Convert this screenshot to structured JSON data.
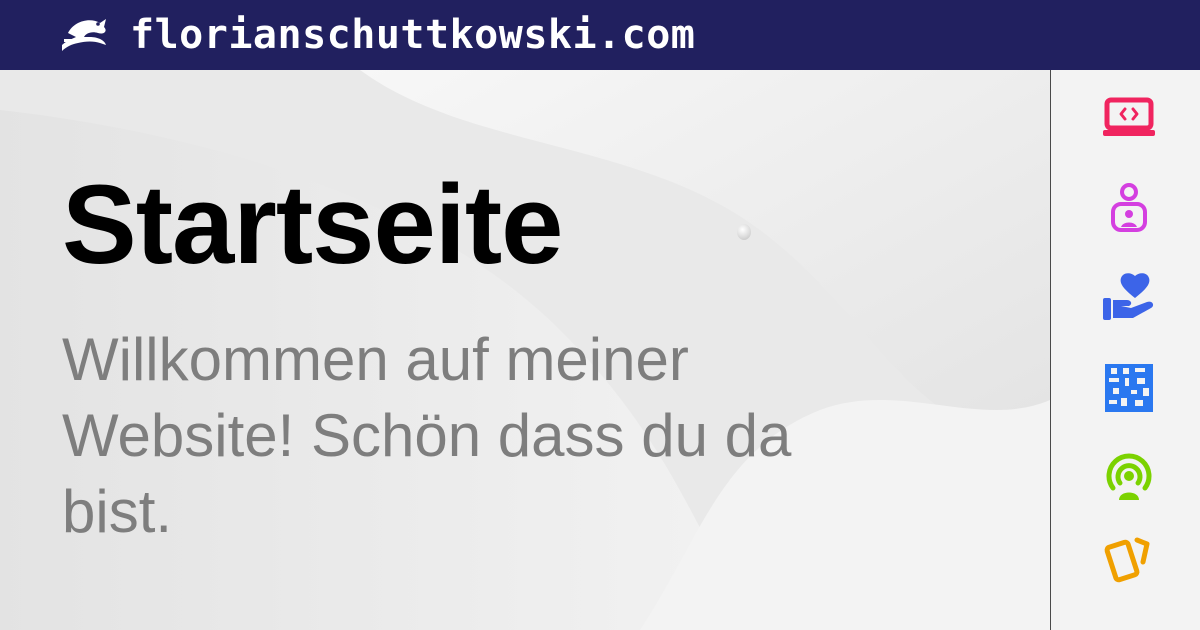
{
  "header": {
    "logo_icon": "dragon-logo-icon",
    "domain": "florianschuttkowski.com",
    "background_color": "#21205f"
  },
  "main": {
    "title": "Startseite",
    "subtitle": "Willkommen auf meiner Website! Schön dass du da bist."
  },
  "sidebar": {
    "icons": [
      {
        "name": "laptop-code-icon",
        "color": "#f0245f"
      },
      {
        "name": "user-badge-icon",
        "color": "#d43fe0"
      },
      {
        "name": "hand-heart-icon",
        "color": "#3c64e8"
      },
      {
        "name": "qr-code-icon",
        "color": "#2a78f0"
      },
      {
        "name": "podcast-icon",
        "color": "#7bd200"
      },
      {
        "name": "cards-icon",
        "color": "#f0a000"
      }
    ]
  }
}
